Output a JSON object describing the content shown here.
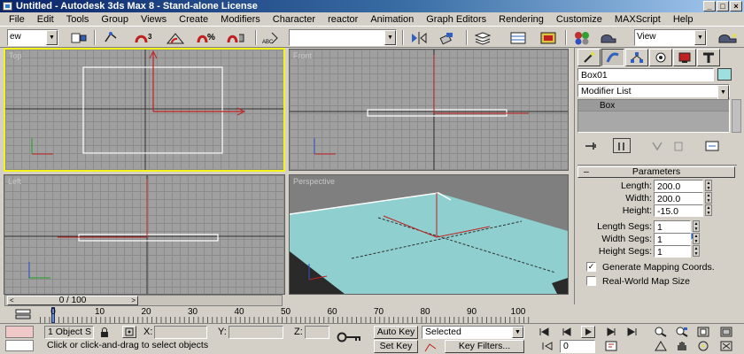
{
  "window": {
    "title": "Untitled - Autodesk 3ds Max 8 - Stand-alone License"
  },
  "menu": [
    "File",
    "Edit",
    "Tools",
    "Group",
    "Views",
    "Create",
    "Modifiers",
    "Character",
    "reactor",
    "Animation",
    "Graph Editors",
    "Rendering",
    "Customize",
    "MAXScript",
    "Help"
  ],
  "toolbar": {
    "selection_filter": "ew",
    "named_selection": "",
    "reference_coord": "View"
  },
  "viewports": {
    "top_label": "Top",
    "front_label": "Front",
    "left_label": "Left",
    "persp_label": "Perspective"
  },
  "command_panel": {
    "object_name": "Box01",
    "object_color": "#9ee0e0",
    "modifier_list": "Modifier List",
    "stack_items": [
      "Box"
    ],
    "rollout_title": "Parameters",
    "params": [
      {
        "label": "Length:",
        "value": "200.0"
      },
      {
        "label": "Width:",
        "value": "200.0"
      },
      {
        "label": "Height:",
        "value": "-15.0"
      },
      {
        "label": "Length Segs:",
        "value": "1"
      },
      {
        "label": "Width Segs:",
        "value": "1"
      },
      {
        "label": "Height Segs:",
        "value": "1"
      }
    ],
    "checkboxes": [
      {
        "label": "Generate Mapping Coords.",
        "checked": true,
        "mark": "✓"
      },
      {
        "label": "Real-World Map Size",
        "checked": false,
        "mark": ""
      }
    ]
  },
  "timeline": {
    "slider_label": "0 / 100",
    "current_frame": 0,
    "total_frames": 100,
    "ticks": [
      "0",
      "10",
      "20",
      "30",
      "40",
      "50",
      "60",
      "70",
      "80",
      "90",
      "100"
    ]
  },
  "status": {
    "selection_count": "1 Object S",
    "x_label": "X:",
    "y_label": "Y:",
    "z_label": "Z:",
    "x_value": "",
    "y_value": "",
    "z_value": "",
    "prompt": "Click or click-and-drag to select objects",
    "auto_key": "Auto Key",
    "set_key": "Set Key",
    "key_mode": "Selected",
    "key_filters": "Key Filters...",
    "frame_value": "0"
  },
  "colors": {
    "active_viewport_border": "#f4f41c",
    "box_color": "#9ee0e0",
    "title_bar": "#0a246a"
  }
}
